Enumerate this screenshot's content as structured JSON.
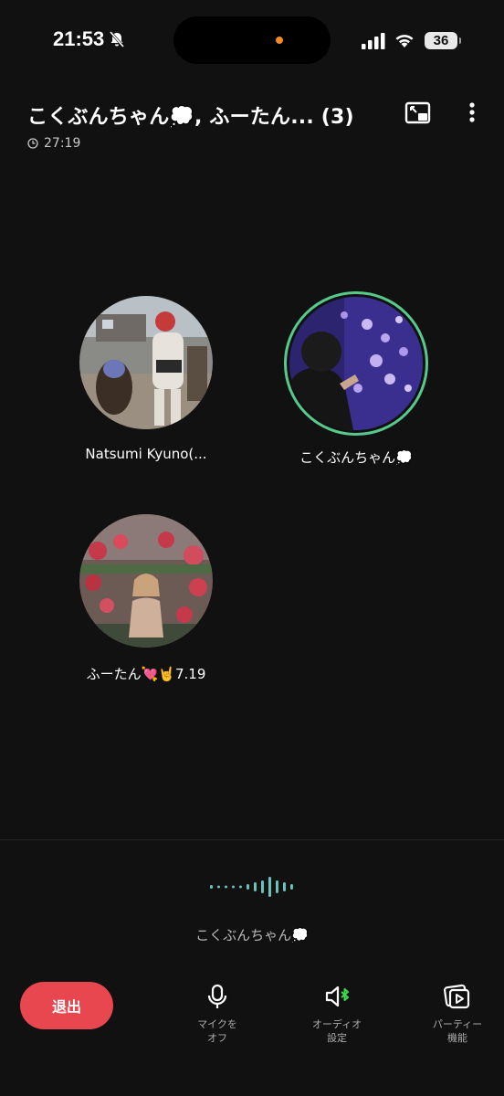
{
  "status_bar": {
    "time": "21:53",
    "battery": "36",
    "icons": [
      "bell-slash-icon",
      "signal-icon",
      "wifi-icon",
      "battery-icon"
    ],
    "island_indicator_color": "#f08a2c"
  },
  "header": {
    "title": "こくぶんちゃん💭, ふーたん...  (3)",
    "duration": "27:19",
    "icons": [
      "clock-icon",
      "picture-in-picture-icon",
      "more-vertical-icon"
    ]
  },
  "participants": [
    {
      "name": "Natsumi Kyuno(...",
      "speaking": false
    },
    {
      "name": "こくぶんちゃん💭",
      "speaking": true
    },
    {
      "name": "ふーたん💘🤘7.19",
      "speaking": false
    }
  ],
  "speaking_indicator": {
    "name": "こくぶんちゃん💭",
    "colors": [
      "#7fb8e6",
      "#57c98a"
    ]
  },
  "controls": {
    "leave_label": "退出",
    "mic_label": "マイクを\nオフ",
    "audio_label": "オーディオ\n設定",
    "party_label": "パーティー\n機能"
  },
  "colors": {
    "background": "#111111",
    "leave_button": "#e9474f",
    "speaking_ring": "#57c98a",
    "bluetooth_accent": "#3ddc4a"
  }
}
